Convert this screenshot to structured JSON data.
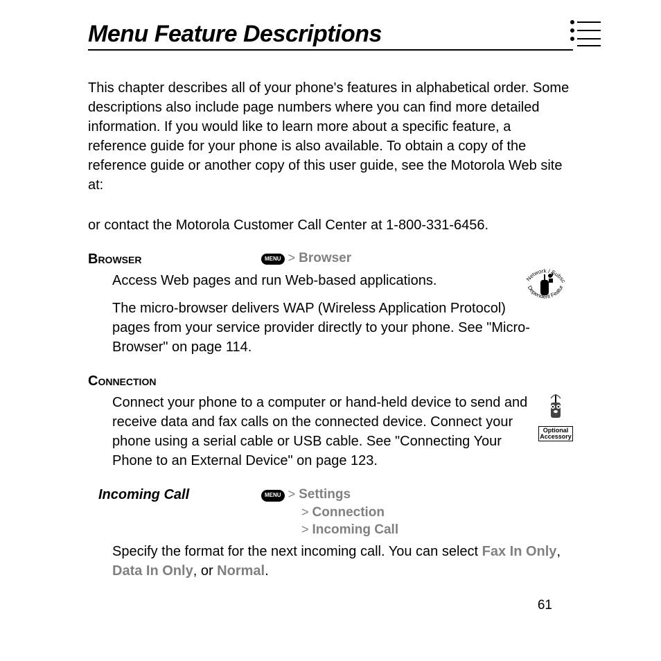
{
  "title": "Menu Feature Descriptions",
  "intro": "This chapter describes all of your phone's features in alphabetical order. Some descriptions also include page numbers where you can find more detailed information. If you would like to learn more about a specific feature, a reference guide for your phone is also available. To obtain a copy of the reference guide or another copy of this user guide, see the Motorola Web site at:",
  "contact": "or contact the Motorola Customer Call Center at 1-800-331-6456.",
  "menu_key_label": "MENU",
  "browser": {
    "heading": "Browser",
    "path1": "Browser",
    "desc1": "Access Web pages and run Web-based applications.",
    "desc2": "The micro-browser delivers WAP (Wireless Application Protocol) pages from your service provider directly to your phone. See \"Micro-Browser\" on page 114."
  },
  "connection": {
    "heading": "Connection",
    "desc": "Connect your phone to a computer or hand-held device to send and receive data and fax calls on the connected device. Connect your phone using a serial cable or USB cable. See \"Connecting Your Phone to an External Device\" on page 123."
  },
  "incoming": {
    "heading": "Incoming Call",
    "path1": "Settings",
    "path2": "Connection",
    "path3": "Incoming Call",
    "desc_pre": "Specify the format for the next incoming call. You can select ",
    "opt1": "Fax In Only",
    "sep1": ", ",
    "opt2": "Data In Only",
    "sep2": ", or ",
    "opt3": "Normal",
    "end": "."
  },
  "icons": {
    "network_feature": "Network/Subscription Dependent Feature",
    "optional_accessory_l1": "Optional",
    "optional_accessory_l2": "Accessory"
  },
  "page_number": "61"
}
